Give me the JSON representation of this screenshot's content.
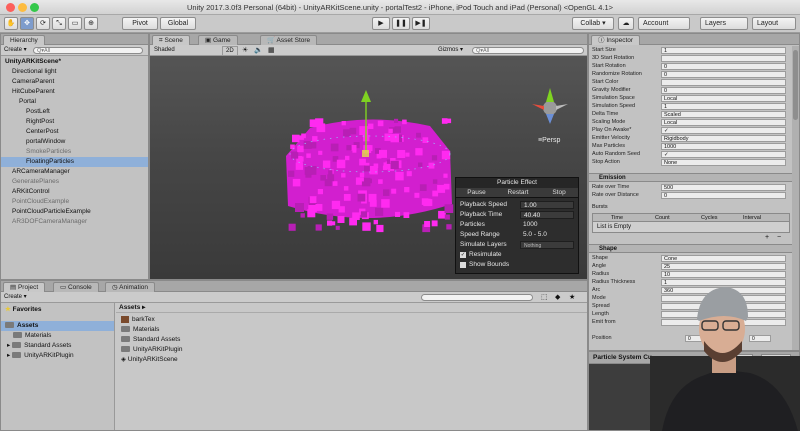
{
  "window": {
    "title": "Unity 2017.3.0f3 Personal (64bit) - UnityARKitScene.unity - portalTest2 - iPhone, iPod Touch and iPad (Personal) <OpenGL 4.1>"
  },
  "toolbar": {
    "pivot": "Pivot",
    "global": "Global",
    "collab": "Collab ▾",
    "account": "Account",
    "layers": "Layers",
    "layout": "Layout"
  },
  "hierarchy": {
    "tab": "Hierarchy",
    "create": "Create ▾",
    "search_placeholder": "Q▾All",
    "items": [
      {
        "label": "UnityARKitScene*",
        "indent": 0,
        "style": "bold"
      },
      {
        "label": "Directional light",
        "indent": 1,
        "style": ""
      },
      {
        "label": "CameraParent",
        "indent": 1,
        "style": ""
      },
      {
        "label": "HitCubeParent",
        "indent": 1,
        "style": ""
      },
      {
        "label": "Portal",
        "indent": 2,
        "style": ""
      },
      {
        "label": "PostLeft",
        "indent": 3,
        "style": ""
      },
      {
        "label": "RightPost",
        "indent": 3,
        "style": ""
      },
      {
        "label": "CenterPost",
        "indent": 3,
        "style": ""
      },
      {
        "label": "portalWindow",
        "indent": 3,
        "style": ""
      },
      {
        "label": "SmokeParticles",
        "indent": 3,
        "style": "dim"
      },
      {
        "label": "FloatingParticles",
        "indent": 3,
        "style": "sel"
      },
      {
        "label": "ARCameraManager",
        "indent": 1,
        "style": ""
      },
      {
        "label": "GeneratePlanes",
        "indent": 1,
        "style": "dim"
      },
      {
        "label": "ARKitControl",
        "indent": 1,
        "style": ""
      },
      {
        "label": "PointCloudExample",
        "indent": 1,
        "style": "dim"
      },
      {
        "label": "PointCloudParticleExample",
        "indent": 1,
        "style": ""
      },
      {
        "label": "AR3DOFCameraManager",
        "indent": 1,
        "style": "dim"
      }
    ]
  },
  "scene": {
    "tabs": [
      "Scene",
      "Game",
      "Asset Store"
    ],
    "shaded": "Shaded",
    "mode2d": "2D",
    "gizmos": "Gizmos ▾",
    "search_placeholder": "Q▾All",
    "persp": "≡Persp",
    "particle_effect": {
      "title": "Particle Effect",
      "buttons": [
        "Pause",
        "Restart",
        "Stop"
      ],
      "rows": [
        {
          "label": "Playback Speed",
          "value": "1.00"
        },
        {
          "label": "Playback Time",
          "value": "40.40"
        },
        {
          "label": "Particles",
          "value": "1000"
        },
        {
          "label": "Speed Range",
          "value": "5.0 - 5.0"
        },
        {
          "label": "Simulate Layers",
          "value": "Nothing"
        }
      ],
      "checks": [
        {
          "label": "Resimulate",
          "checked": true
        },
        {
          "label": "Show Bounds",
          "checked": false
        }
      ]
    }
  },
  "inspector": {
    "tab": "Inspector",
    "rows": [
      {
        "label": "Start Size",
        "value": "1"
      },
      {
        "label": "3D Start Rotation",
        "value": ""
      },
      {
        "label": "Start Rotation",
        "value": "0"
      },
      {
        "label": "Randomize Rotation",
        "value": "0"
      },
      {
        "label": "Start Color",
        "value": ""
      },
      {
        "label": "Gravity Modifier",
        "value": "0"
      },
      {
        "label": "Simulation Space",
        "value": "Local"
      },
      {
        "label": "Simulation Speed",
        "value": "1"
      },
      {
        "label": "Delta Time",
        "value": "Scaled"
      },
      {
        "label": "Scaling Mode",
        "value": "Local"
      },
      {
        "label": "Play On Awake*",
        "value": "✓"
      },
      {
        "label": "Emitter Velocity",
        "value": "Rigidbody"
      },
      {
        "label": "Max Particles",
        "value": "1000"
      },
      {
        "label": "Auto Random Seed",
        "value": "✓"
      },
      {
        "label": "Stop Action",
        "value": "None"
      }
    ],
    "emission": {
      "title": "Emission",
      "rows": [
        {
          "label": "Rate over Time",
          "value": "500"
        },
        {
          "label": "Rate over Distance",
          "value": "0"
        }
      ],
      "bursts_label": "Bursts",
      "bursts_cols": [
        "Time",
        "Count",
        "Cycles",
        "Interval"
      ],
      "bursts_empty": "List is Empty"
    },
    "shape": {
      "title": "Shape",
      "rows": [
        {
          "label": "Shape",
          "value": "Cone"
        },
        {
          "label": "Angle",
          "value": "25"
        },
        {
          "label": "Radius",
          "value": "10"
        },
        {
          "label": "Radius Thickness",
          "value": "1"
        },
        {
          "label": "Arc",
          "value": "360"
        },
        {
          "label": "Mode",
          "value": ""
        },
        {
          "label": "Spread",
          "value": ""
        },
        {
          "label": "Length",
          "value": ""
        },
        {
          "label": "Emit from",
          "value": ""
        }
      ],
      "position_label": "Position",
      "position_vals": [
        "0",
        "0",
        "0"
      ]
    },
    "curves": {
      "title": "Particle System Cu",
      "buttons": [
        "Optimize",
        "Remove"
      ]
    }
  },
  "project": {
    "tabs": [
      "Project",
      "Console",
      "Animation"
    ],
    "create": "Create ▾",
    "favorites": "Favorites",
    "assets_tree": [
      "Assets",
      "Materials",
      "Standard Assets",
      "UnityARKitPlugin"
    ],
    "assets_header": "Assets ▸",
    "files": [
      {
        "name": "barkTex",
        "icon": "texture"
      },
      {
        "name": "Materials",
        "icon": "folder"
      },
      {
        "name": "Standard Assets",
        "icon": "folder"
      },
      {
        "name": "UnityARKitPlugin",
        "icon": "folder"
      },
      {
        "name": "UnityARKitScene",
        "icon": "unity"
      }
    ]
  },
  "colors": {
    "particle": "#ff2af0",
    "particle_dark": "#b81fb5",
    "sky": "#4a4a4a"
  }
}
